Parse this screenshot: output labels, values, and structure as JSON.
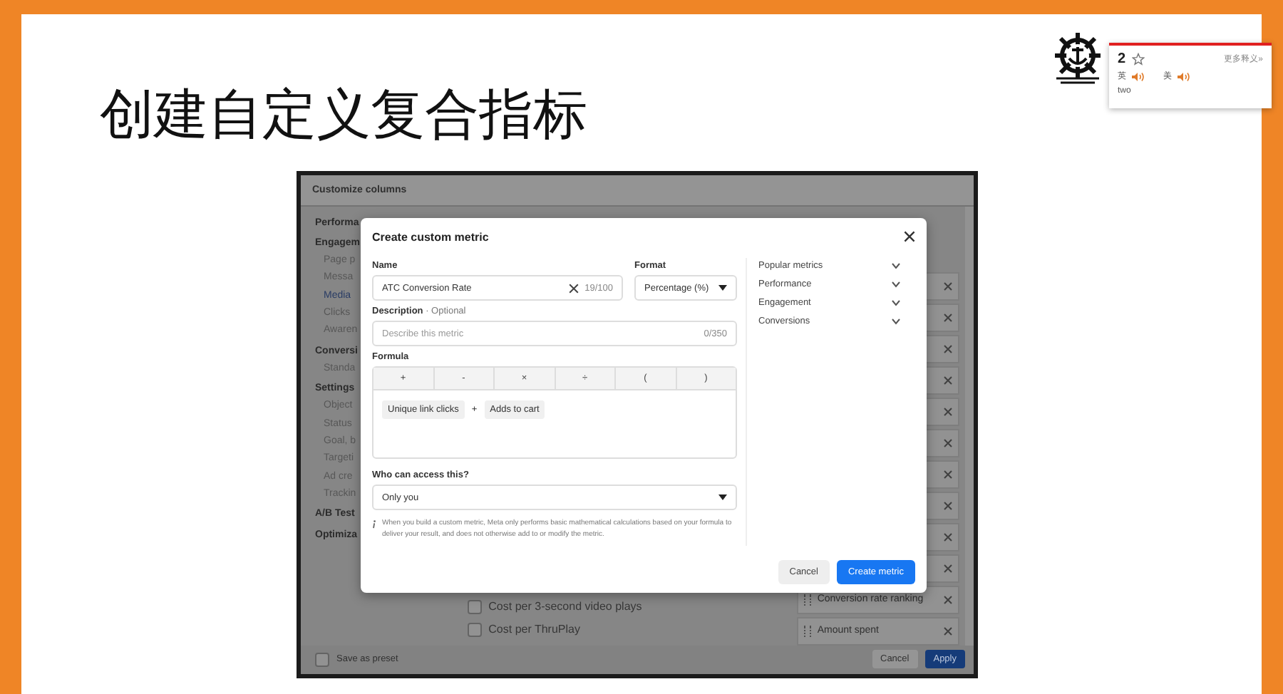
{
  "slide": {
    "title": "创建自定义复合指标"
  },
  "dictionary_popup": {
    "word": "2",
    "more_link": "更多释义»",
    "pronunciations": [
      {
        "label": "英"
      },
      {
        "label": "美"
      }
    ],
    "definition": "two"
  },
  "customize_columns": {
    "title": "Customize columns",
    "sidebar_items": [
      {
        "kind": "heading",
        "label": "Performa"
      },
      {
        "kind": "heading",
        "label": "Engagem"
      },
      {
        "kind": "sub",
        "label": "Page p"
      },
      {
        "kind": "sub",
        "label": "Messa"
      },
      {
        "kind": "active",
        "label": "Media"
      },
      {
        "kind": "sub",
        "label": "Clicks"
      },
      {
        "kind": "sub",
        "label": "Awaren"
      },
      {
        "kind": "heading",
        "label": "Conversi"
      },
      {
        "kind": "sub",
        "label": "Standa"
      },
      {
        "kind": "heading",
        "label": "Settings"
      },
      {
        "kind": "sub",
        "label": "Object"
      },
      {
        "kind": "sub",
        "label": "Status"
      },
      {
        "kind": "sub",
        "label": "Goal, b"
      },
      {
        "kind": "sub",
        "label": "Targeti"
      },
      {
        "kind": "sub",
        "label": "Ad cre"
      },
      {
        "kind": "sub",
        "label": "Trackin"
      },
      {
        "kind": "heading",
        "label": "A/B Test"
      },
      {
        "kind": "heading",
        "label": "Optimiza"
      }
    ],
    "metric_options": [
      {
        "label": "Cost per 3-second video plays",
        "checked": false
      },
      {
        "label": "Cost per ThruPlay",
        "checked": false
      }
    ],
    "selected_columns": [
      "Conversion rate ranking",
      "Amount spent"
    ],
    "save_preset": {
      "label": "Save as preset",
      "checked": false
    },
    "buttons": [
      {
        "label": "Cancel",
        "kind": "secondary"
      },
      {
        "label": "Apply",
        "kind": "primary"
      }
    ]
  },
  "modal": {
    "title": "Create custom metric",
    "name": {
      "label": "Name",
      "value": "ATC Conversion Rate",
      "counter": "19/100"
    },
    "format": {
      "label": "Format",
      "value": "Percentage (%)"
    },
    "description": {
      "label": "Description",
      "optional": "· Optional",
      "placeholder": "Describe this metric",
      "counter": "0/350"
    },
    "formula": {
      "label": "Formula",
      "operators": [
        "+",
        "-",
        "×",
        "÷",
        "(",
        ")"
      ],
      "tokens": [
        {
          "kind": "metric",
          "text": "Unique link clicks"
        },
        {
          "kind": "operator",
          "text": "+"
        },
        {
          "kind": "metric",
          "text": "Adds to cart"
        }
      ]
    },
    "access": {
      "label": "Who can access this?",
      "value": "Only you"
    },
    "note": "When you build a custom metric, Meta only performs basic mathematical calculations based on your formula to deliver your result, and does not otherwise add to or modify the metric.",
    "metric_groups": [
      {
        "label": "Popular metrics",
        "expanded": false
      },
      {
        "label": "Performance",
        "expanded": false
      },
      {
        "label": "Engagement",
        "expanded": false
      },
      {
        "label": "Conversions",
        "expanded": false
      }
    ],
    "buttons": [
      {
        "label": "Cancel",
        "kind": "secondary"
      },
      {
        "label": "Create metric",
        "kind": "primary"
      }
    ]
  }
}
